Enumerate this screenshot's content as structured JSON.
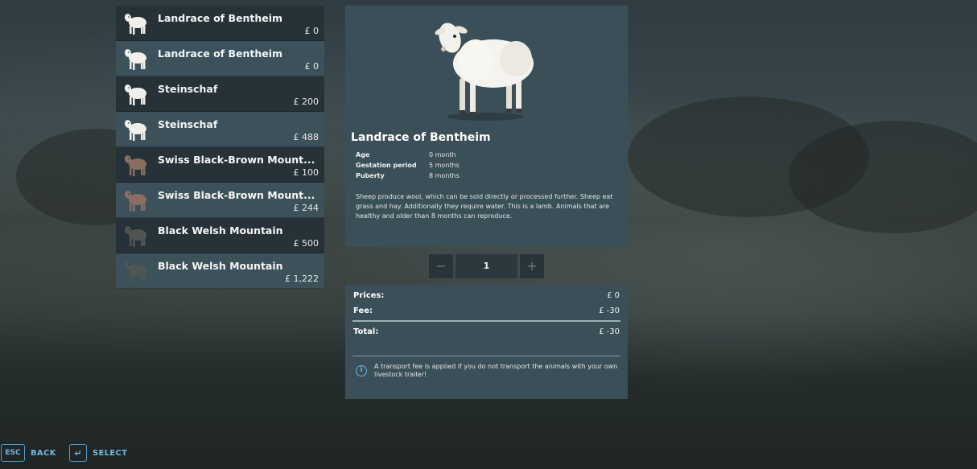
{
  "animals": [
    {
      "name": "Landrace of Bentheim",
      "price": "£ 0",
      "color": "#f1f0ea"
    },
    {
      "name": "Landrace of Bentheim",
      "price": "£ 0",
      "color": "#f1f0ea"
    },
    {
      "name": "Steinschaf",
      "price": "£ 200",
      "color": "#f1f0ea"
    },
    {
      "name": "Steinschaf",
      "price": "£ 488",
      "color": "#f1f0ea"
    },
    {
      "name": "Swiss Black-Brown Mount...",
      "price": "£ 100",
      "color": "#8a6e62"
    },
    {
      "name": "Swiss Black-Brown Mount...",
      "price": "£ 244",
      "color": "#8a6e62"
    },
    {
      "name": "Black Welsh Mountain",
      "price": "£ 500",
      "color": "#505552"
    },
    {
      "name": "Black Welsh Mountain",
      "price": "£ 1,222",
      "color": "#505552"
    }
  ],
  "detail": {
    "title": "Landrace of Bentheim",
    "attributes": [
      {
        "label": "Age",
        "value": "0 month"
      },
      {
        "label": "Gestation period",
        "value": "5 months"
      },
      {
        "label": "Puberty",
        "value": "8 months"
      }
    ],
    "description": "Sheep produce wool, which can be sold directly or processed further. Sheep eat grass and hay. Additionally they require water. This is a lamb. Animals that are healthy and older than 8 months can reproduce."
  },
  "quantity": {
    "minus": "−",
    "value": "1",
    "plus": "+"
  },
  "pricing": {
    "prices_label": "Prices:",
    "prices_value": "£ 0",
    "fee_label": "Fee:",
    "fee_value": "£ -30",
    "total_label": "Total:",
    "total_value": "£ -30",
    "info_icon": "i",
    "info_text": "A transport fee is applied if you do not transport the animals with your own livestock trailer!"
  },
  "hints": {
    "back_key": "ESC",
    "back_label": "BACK",
    "select_key": "↵",
    "select_label": "SELECT"
  }
}
